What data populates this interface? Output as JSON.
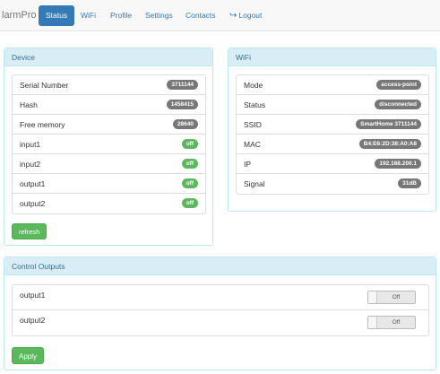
{
  "nav": {
    "brand": "larmPro",
    "items": [
      "Status",
      "WiFi",
      "Profile",
      "Settings",
      "Contacts"
    ],
    "logout": "Logout"
  },
  "device": {
    "title": "Device",
    "rows": [
      {
        "label": "Serial Number",
        "value": "3711144",
        "color": "gray"
      },
      {
        "label": "Hash",
        "value": "1458415",
        "color": "gray"
      },
      {
        "label": "Free memory",
        "value": "28640",
        "color": "gray"
      },
      {
        "label": "input1",
        "value": "off",
        "color": "green"
      },
      {
        "label": "input2",
        "value": "off",
        "color": "green"
      },
      {
        "label": "output1",
        "value": "off",
        "color": "green"
      },
      {
        "label": "output2",
        "value": "off",
        "color": "green"
      }
    ],
    "refresh_label": "refresh"
  },
  "wifi": {
    "title": "WiFi",
    "rows": [
      {
        "label": "Mode",
        "value": "access-point"
      },
      {
        "label": "Status",
        "value": "disconnected"
      },
      {
        "label": "SSID",
        "value": "SmartHome 3711144"
      },
      {
        "label": "MAC",
        "value": "B4:E6:2D:38:A0:A8"
      },
      {
        "label": "IP",
        "value": "192.168.200.1"
      },
      {
        "label": "Signal",
        "value": "31dB"
      }
    ]
  },
  "control": {
    "title": "Control Outputs",
    "outputs": [
      {
        "label": "output1",
        "state": "Off"
      },
      {
        "label": "output2",
        "state": "Off"
      }
    ],
    "apply_label": "Apply"
  },
  "colors": {
    "primary": "#337ab7",
    "success": "#5cb85c",
    "info_bg": "#d9edf7",
    "info_border": "#bce8f1",
    "badge_gray": "#777777"
  }
}
